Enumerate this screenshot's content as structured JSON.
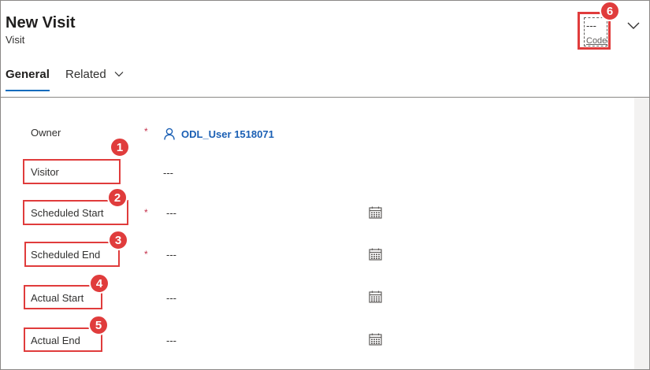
{
  "header": {
    "title": "New Visit",
    "subtitle": "Visit",
    "code": {
      "value": "---",
      "label": "Code"
    }
  },
  "tabs": [
    {
      "label": "General",
      "active": true
    },
    {
      "label": "Related",
      "active": false
    }
  ],
  "form": {
    "owner": {
      "label": "Owner",
      "required_mark": "*",
      "value": "ODL_User 1518071"
    },
    "visitor": {
      "label": "Visitor",
      "value": "---"
    },
    "scheduled_start": {
      "label": "Scheduled Start",
      "required_mark": "*",
      "value": "---"
    },
    "scheduled_end": {
      "label": "Scheduled End",
      "required_mark": "*",
      "value": "---"
    },
    "actual_start": {
      "label": "Actual Start",
      "value": "---"
    },
    "actual_end": {
      "label": "Actual End",
      "value": "---"
    }
  },
  "annotations": [
    "1",
    "2",
    "3",
    "4",
    "5",
    "6"
  ],
  "colors": {
    "highlight": "#e03c3c",
    "accent": "#0f6cbd",
    "link": "#1a5fb4",
    "required": "#c4314b"
  },
  "icons": {
    "owner": "person-icon",
    "date": "calendar-icon",
    "expand": "chevron-down-icon"
  }
}
